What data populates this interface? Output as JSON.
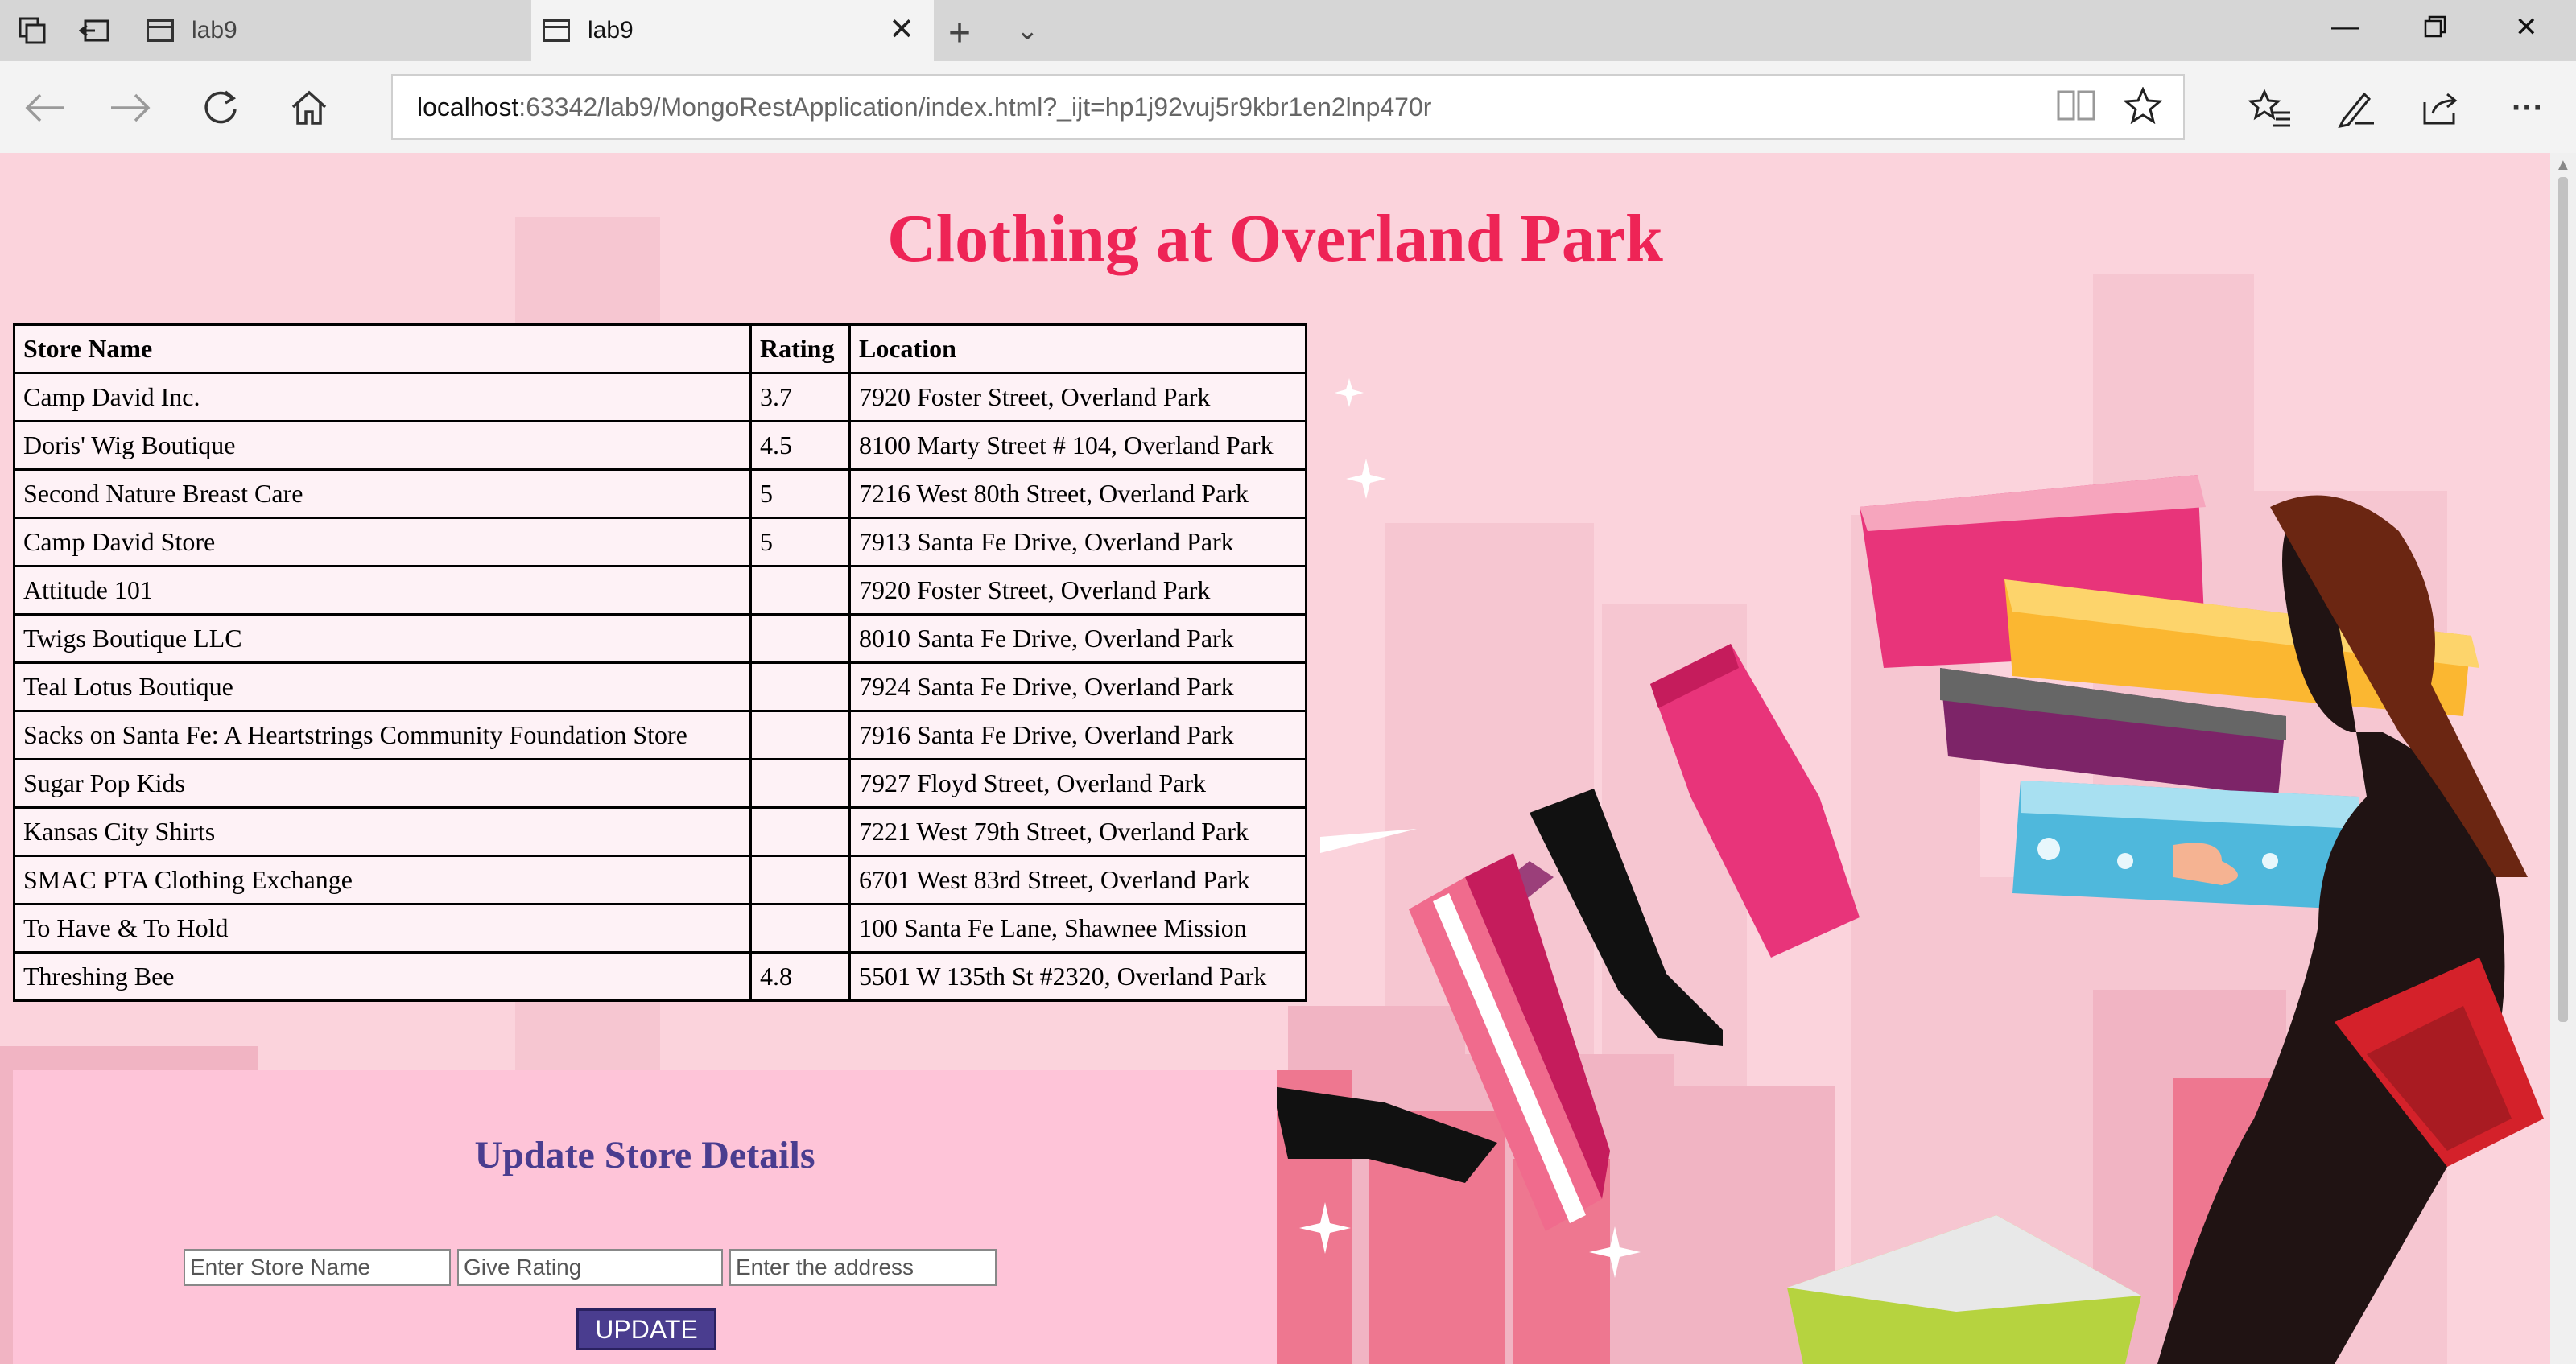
{
  "browser": {
    "tabs": [
      {
        "label": "lab9",
        "active": false
      },
      {
        "label": "lab9",
        "active": true
      }
    ],
    "url_host": "localhost",
    "url_rest": ":63342/lab9/MongoRestApplication/index.html?_ijt=hp1j92vuj5r9kbr1en2lnp470r"
  },
  "page": {
    "title": "Clothing at Overland Park",
    "table": {
      "headers": [
        "Store Name",
        "Rating",
        "Location"
      ],
      "rows": [
        {
          "name": "Camp David Inc.",
          "rating": "3.7",
          "location": "7920 Foster Street, Overland Park"
        },
        {
          "name": "Doris' Wig Boutique",
          "rating": "4.5",
          "location": "8100 Marty Street # 104, Overland Park"
        },
        {
          "name": "Second Nature Breast Care",
          "rating": "5",
          "location": "7216 West 80th Street, Overland Park"
        },
        {
          "name": "Camp David Store",
          "rating": "5",
          "location": "7913 Santa Fe Drive, Overland Park"
        },
        {
          "name": "Attitude 101",
          "rating": "",
          "location": "7920 Foster Street, Overland Park"
        },
        {
          "name": "Twigs Boutique LLC",
          "rating": "",
          "location": "8010 Santa Fe Drive, Overland Park"
        },
        {
          "name": "Teal Lotus Boutique",
          "rating": "",
          "location": "7924 Santa Fe Drive, Overland Park"
        },
        {
          "name": "Sacks on Santa Fe: A Heartstrings Community Foundation Store",
          "rating": "",
          "location": "7916 Santa Fe Drive, Overland Park"
        },
        {
          "name": "Sugar Pop Kids",
          "rating": "",
          "location": "7927 Floyd Street, Overland Park"
        },
        {
          "name": "Kansas City Shirts",
          "rating": "",
          "location": "7221 West 79th Street, Overland Park"
        },
        {
          "name": "SMAC PTA Clothing Exchange",
          "rating": "",
          "location": "6701 West 83rd Street, Overland Park"
        },
        {
          "name": "To Have & To Hold",
          "rating": "",
          "location": "100 Santa Fe Lane, Shawnee Mission"
        },
        {
          "name": "Threshing Bee",
          "rating": "4.8",
          "location": "5501 W 135th St #2320, Overland Park"
        }
      ]
    },
    "update": {
      "title": "Update Store Details",
      "store_name_placeholder": "Enter Store Name",
      "rating_placeholder": "Give Rating",
      "address_placeholder": "Enter the address",
      "button_label": "UPDATE"
    }
  },
  "colors": {
    "title": "#ee2456",
    "update_title": "#4a3d8f",
    "page_bg": "#fbd3dc",
    "panel_bg": "#fec4d8"
  }
}
